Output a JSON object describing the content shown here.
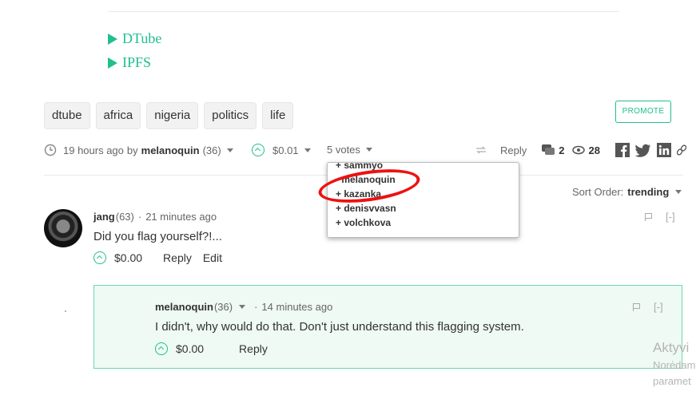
{
  "links": [
    "DTube",
    "IPFS"
  ],
  "tags": [
    "dtube",
    "africa",
    "nigeria",
    "politics",
    "life"
  ],
  "promote_label": "PROMOTE",
  "post_meta": {
    "time": "19 hours ago",
    "by": "by",
    "author": "melanoquin",
    "reputation": "(36)",
    "payout": "$0.01",
    "votes_label": "5 votes",
    "reply_label": "Reply",
    "comments_count": "2",
    "views_count": "28"
  },
  "votes_dropdown": [
    "+ sammyo",
    "- melanoquin",
    "+ kazanka",
    "+ denisvvasn",
    "+ volchkova"
  ],
  "sort_order": {
    "label": "Sort Order:",
    "value": "trending"
  },
  "comments": [
    {
      "author": "jang",
      "reputation": "(63)",
      "time": "21 minutes ago",
      "body": "Did you flag yourself?!...",
      "payout": "$0.00",
      "reply": "Reply",
      "edit": "Edit",
      "collapse": "[-]"
    },
    {
      "author": "melanoquin",
      "reputation": "(36)",
      "time": "14 minutes ago",
      "body": "I didn't, why would do that. Don't just understand this flagging system.",
      "payout": "$0.00",
      "reply": "Reply",
      "collapse": "[-]"
    }
  ],
  "watermark": [
    "Aktyvi",
    "Norėdam",
    "paramet"
  ],
  "colors": {
    "accent": "#1fbf8f",
    "highlight": "#ee1111"
  }
}
